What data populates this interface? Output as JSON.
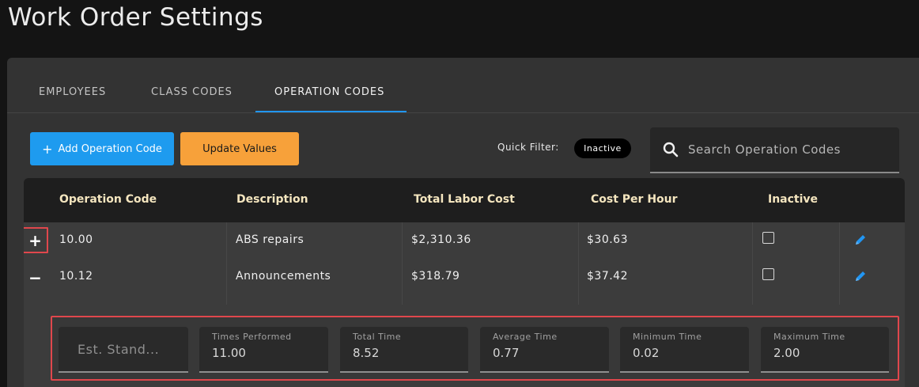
{
  "page": {
    "title": "Work Order Settings"
  },
  "tabs": [
    {
      "label": "EMPLOYEES",
      "active": false
    },
    {
      "label": "CLASS CODES",
      "active": false
    },
    {
      "label": "OPERATION CODES",
      "active": true
    }
  ],
  "toolbar": {
    "add_label": "Add Operation Code",
    "add_icon": "plus-icon",
    "update_label": "Update Values",
    "quick_filter_label": "Quick Filter:",
    "quick_filter_chip": "Inactive",
    "search_placeholder": "Search Operation Codes",
    "search_icon": "search-icon"
  },
  "colors": {
    "accent": "#1e9bef",
    "update": "#f7a13a",
    "highlight": "#e0474c",
    "header_text": "#f5e6bf"
  },
  "table": {
    "columns": [
      "Operation Code",
      "Description",
      "Total Labor Cost",
      "Cost Per Hour",
      "Inactive"
    ],
    "rows": [
      {
        "expander": "+",
        "code": "10.00",
        "description": "ABS repairs",
        "total_labor_cost": "$2,310.36",
        "cost_per_hour": "$30.63",
        "inactive": false,
        "expanded": false
      },
      {
        "expander": "−",
        "code": "10.12",
        "description": "Announcements",
        "total_labor_cost": "$318.79",
        "cost_per_hour": "$37.42",
        "inactive": false,
        "expanded": true
      }
    ]
  },
  "detail": {
    "est_standard_placeholder": "Est. Stand...",
    "fields": [
      {
        "label": "Times Performed",
        "value": "11.00"
      },
      {
        "label": "Total Time",
        "value": "8.52"
      },
      {
        "label": "Average Time",
        "value": "0.77"
      },
      {
        "label": "Minimum Time",
        "value": "0.02"
      },
      {
        "label": "Maximum Time",
        "value": "2.00"
      }
    ]
  }
}
